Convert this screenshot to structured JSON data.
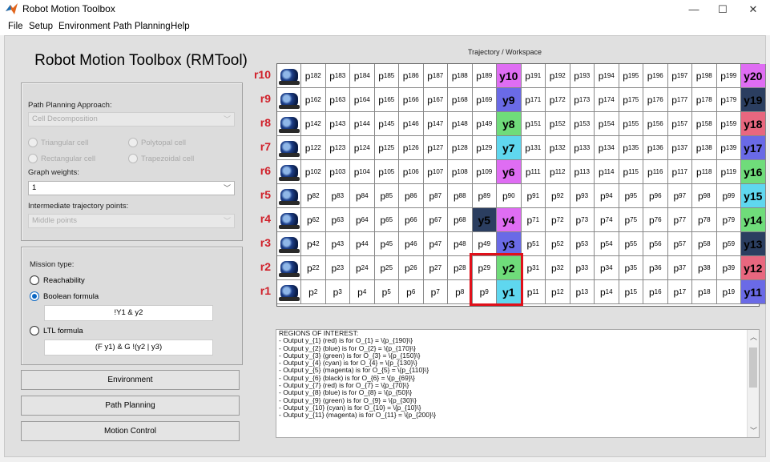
{
  "window": {
    "title": "Robot Motion Toolbox",
    "minimize": "—",
    "maximize": "☐",
    "close": "✕"
  },
  "menu": [
    "File",
    "Setup",
    "Environment",
    "Path Planning",
    "Help"
  ],
  "app_title": "Robot Motion Toolbox (RMTool)",
  "path_panel": {
    "approach_label": "Path Planning Approach:",
    "approach_value": "Cell Decomposition",
    "cell_types": [
      "Triangular cell",
      "Polytopal cell",
      "Rectangular cell",
      "Trapezoidal cell"
    ],
    "weights_label": "Graph weights:",
    "weights_value": "1",
    "intermediate_label": "Intermediate trajectory points:",
    "intermediate_value": "Middle points"
  },
  "mission_panel": {
    "label": "Mission type:",
    "options": [
      "Reachability",
      "Boolean formula",
      "LTL formula"
    ],
    "selected": "Boolean formula",
    "boolean_formula": "!Y1 & y2",
    "ltl_formula": "(F y1) & G !(y2 | y3)"
  },
  "buttons": {
    "environment": "Environment",
    "path_planning": "Path Planning",
    "motion_control": "Motion Control"
  },
  "workspace_title": "Trajectory / Workspace",
  "colors": {
    "red": "#e8677f",
    "blue": "#6a6ae6",
    "green": "#6fdc7a",
    "cyan": "#5fd7ef",
    "magenta": "#df6df3",
    "black": "#2b3e60",
    "highlight": "#e0101a"
  },
  "grid": {
    "rows": [
      {
        "label": "r10",
        "cells": [
          "p182",
          "p183",
          "p184",
          "p185",
          "p186",
          "p187",
          "p188",
          "p189",
          "y10",
          "p191",
          "p192",
          "p193",
          "p194",
          "p195",
          "p196",
          "p197",
          "p198",
          "p199",
          "y20"
        ]
      },
      {
        "label": "r9",
        "cells": [
          "p162",
          "p163",
          "p164",
          "p165",
          "p166",
          "p167",
          "p168",
          "p169",
          "y9",
          "p171",
          "p172",
          "p173",
          "p174",
          "p175",
          "p176",
          "p177",
          "p178",
          "p179",
          "y19"
        ]
      },
      {
        "label": "r8",
        "cells": [
          "p142",
          "p143",
          "p144",
          "p145",
          "p146",
          "p147",
          "p148",
          "p149",
          "y8",
          "p151",
          "p152",
          "p153",
          "p154",
          "p155",
          "p156",
          "p157",
          "p158",
          "p159",
          "y18"
        ]
      },
      {
        "label": "r7",
        "cells": [
          "p122",
          "p123",
          "p124",
          "p125",
          "p126",
          "p127",
          "p128",
          "p129",
          "y7",
          "p131",
          "p132",
          "p133",
          "p134",
          "p135",
          "p136",
          "p137",
          "p138",
          "p139",
          "y17"
        ]
      },
      {
        "label": "r6",
        "cells": [
          "p102",
          "p103",
          "p104",
          "p105",
          "p106",
          "p107",
          "p108",
          "p109",
          "y6",
          "p111",
          "p112",
          "p113",
          "p114",
          "p115",
          "p116",
          "p117",
          "p118",
          "p119",
          "y16"
        ]
      },
      {
        "label": "r5",
        "cells": [
          "p82",
          "p83",
          "p84",
          "p85",
          "p86",
          "p87",
          "p88",
          "p89",
          "p90",
          "p91",
          "p92",
          "p93",
          "p94",
          "p95",
          "p96",
          "p97",
          "p98",
          "p99",
          "y15"
        ]
      },
      {
        "label": "r4",
        "cells": [
          "p62",
          "p63",
          "p64",
          "p65",
          "p66",
          "p67",
          "p68",
          "y5",
          "y4",
          "p71",
          "p72",
          "p73",
          "p74",
          "p75",
          "p76",
          "p77",
          "p78",
          "p79",
          "y14"
        ]
      },
      {
        "label": "r3",
        "cells": [
          "p42",
          "p43",
          "p44",
          "p45",
          "p46",
          "p47",
          "p48",
          "p49",
          "y3",
          "p51",
          "p52",
          "p53",
          "p54",
          "p55",
          "p56",
          "p57",
          "p58",
          "p59",
          "y13"
        ]
      },
      {
        "label": "r2",
        "cells": [
          "p22",
          "p23",
          "p24",
          "p25",
          "p26",
          "p27",
          "p28",
          "p29",
          "y2",
          "p31",
          "p32",
          "p33",
          "p34",
          "p35",
          "p36",
          "p37",
          "p38",
          "p39",
          "y12"
        ]
      },
      {
        "label": "r1",
        "cells": [
          "p2",
          "p3",
          "p4",
          "p5",
          "p6",
          "p7",
          "p8",
          "p9",
          "y1",
          "p11",
          "p12",
          "p13",
          "p14",
          "p15",
          "p16",
          "p17",
          "p18",
          "p19",
          "y11"
        ]
      }
    ],
    "region_colors": {
      "y1": "cyan",
      "y2": "green",
      "y3": "blue",
      "y4": "magenta",
      "y5": "black",
      "y6": "magenta",
      "y7": "cyan",
      "y8": "green",
      "y9": "blue",
      "y10": "magenta",
      "y11": "blue",
      "y12": "red",
      "y13": "black",
      "y14": "green",
      "y15": "cyan",
      "y16": "green",
      "y17": "blue",
      "y18": "red",
      "y19": "black",
      "y20": "magenta"
    }
  },
  "console": [
    "REGIONS OF INTEREST:",
    "- Output y_{1} (red) is for O_{1} = \\{p_{190}\\}",
    "- Output y_{2} (blue) is for O_{2} = \\{p_{170}\\}",
    "- Output y_{3} (green) is for O_{3} = \\{p_{150}\\}",
    "- Output y_{4} (cyan) is for O_{4} = \\{p_{130}\\}",
    "- Output y_{5} (magenta) is for O_{5} = \\{p_{110}\\}",
    "- Output y_{6} (black) is for O_{6} = \\{p_{69}\\}",
    "- Output y_{7} (red) is for O_{7} = \\{p_{70}\\}",
    "- Output y_{8} (blue) is for O_{8} = \\{p_{50}\\}",
    "- Output y_{9} (green) is for O_{9} = \\{p_{30}\\}",
    "- Output y_{10} (cyan) is for O_{10} = \\{p_{10}\\}",
    "- Output y_{11} (magenta) is for O_{11} = \\{p_{200}\\}"
  ]
}
